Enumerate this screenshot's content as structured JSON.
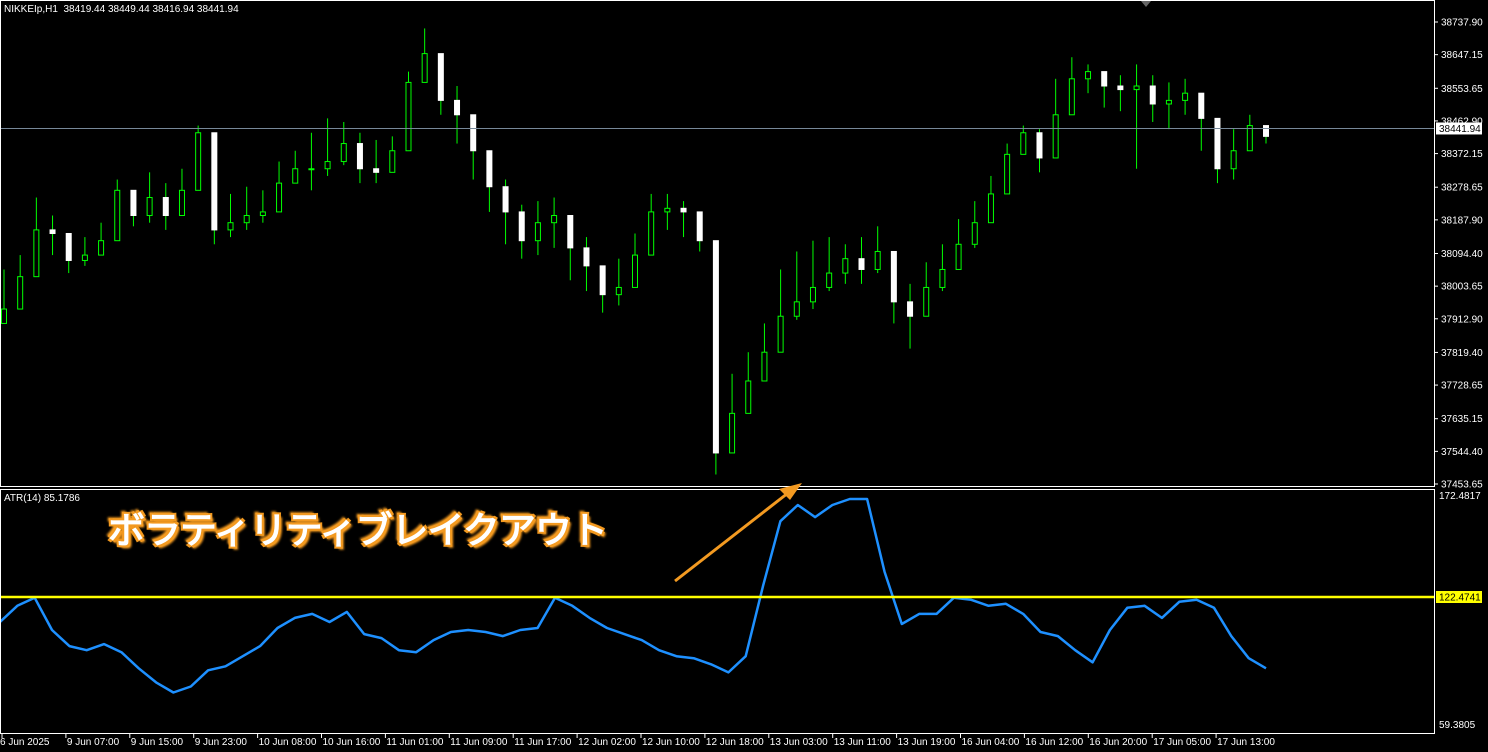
{
  "symbol_info": "NIKKEIp,H1  38419.44 38449.44 38416.94 38441.94",
  "atr_info": "ATR(14) 85.1786",
  "annotation": "ボラティリティブレイクアウト",
  "colors": {
    "background": "#000000",
    "bull_candle": "#00ff00",
    "body_fill": "#ffffff",
    "atr_line": "#1e90ff",
    "level_line": "#ffff00",
    "current_price_line": "#778899",
    "arrow": "#f39a21",
    "axis": "#ffffff"
  },
  "price_axis": {
    "ticks": [
      "38737.90",
      "38647.15",
      "38553.65",
      "38462.90",
      "38372.15",
      "38278.65",
      "38187.90",
      "38094.40",
      "38003.65",
      "37912.90",
      "37819.40",
      "37728.65",
      "37635.15",
      "37544.40",
      "37453.65"
    ],
    "current_label": "38441.94"
  },
  "atr_axis": {
    "top_label": "172.4817",
    "bottom_label": "59.3805",
    "level_label": "122.4741"
  },
  "time_axis": {
    "labels": [
      "6 Jun 2025",
      "9 Jun 07:00",
      "9 Jun 15:00",
      "9 Jun 23:00",
      "10 Jun 08:00",
      "10 Jun 16:00",
      "11 Jun 01:00",
      "11 Jun 09:00",
      "11 Jun 17:00",
      "12 Jun 02:00",
      "12 Jun 10:00",
      "12 Jun 18:00",
      "13 Jun 03:00",
      "13 Jun 11:00",
      "13 Jun 19:00",
      "16 Jun 04:00",
      "16 Jun 12:00",
      "16 Jun 20:00",
      "17 Jun 05:00",
      "17 Jun 13:00"
    ]
  },
  "chart_data": [
    {
      "type": "candlestick",
      "title": "NIKKEIp,H1",
      "ylim": [
        37453.65,
        38775
      ],
      "close": [
        37940,
        38030,
        38160,
        38150,
        38075,
        38090,
        38130,
        38270,
        38200,
        38250,
        38200,
        38270,
        38430,
        38160,
        38180,
        38200,
        38210,
        38290,
        38330,
        38330,
        38350,
        38400,
        38330,
        38320,
        38380,
        38570,
        38650,
        38520,
        38480,
        38380,
        38280,
        38210,
        38130,
        38180,
        38200,
        38110,
        38060,
        37980,
        38000,
        38090,
        38210,
        38220,
        38210,
        38130,
        37540,
        37650,
        37740,
        37820,
        37920,
        37960,
        38000,
        38040,
        38080,
        38050,
        38100,
        37960,
        37920,
        38000,
        38050,
        38120,
        38180,
        38260,
        38370,
        38430,
        38360,
        38480,
        38580,
        38600,
        38560,
        38550,
        38560,
        38510,
        38520,
        38540,
        38470,
        38330,
        38380,
        38450,
        38420
      ],
      "high": [
        38050,
        38090,
        38250,
        38200,
        38120,
        38140,
        38180,
        38300,
        38260,
        38320,
        38290,
        38330,
        38450,
        38240,
        38260,
        38280,
        38270,
        38350,
        38380,
        38430,
        38470,
        38460,
        38430,
        38410,
        38420,
        38600,
        38720,
        38640,
        38560,
        38480,
        38360,
        38300,
        38230,
        38240,
        38250,
        38180,
        38140,
        38060,
        38080,
        38150,
        38260,
        38260,
        38240,
        38180,
        37730,
        37760,
        37820,
        37900,
        38050,
        38100,
        38130,
        38140,
        38120,
        38140,
        38170,
        38040,
        38010,
        38070,
        38120,
        38190,
        38240,
        38310,
        38400,
        38450,
        38440,
        38580,
        38640,
        38620,
        38600,
        38590,
        38620,
        38590,
        38570,
        38580,
        38540,
        38470,
        38440,
        38480,
        38450
      ],
      "low": [
        37900,
        37990,
        38130,
        38090,
        38040,
        38060,
        38100,
        38200,
        38170,
        38180,
        38160,
        38240,
        38390,
        38120,
        38140,
        38160,
        38180,
        38250,
        38290,
        38270,
        38310,
        38340,
        38290,
        38290,
        38320,
        38510,
        38590,
        38480,
        38400,
        38300,
        38210,
        38120,
        38080,
        38090,
        38110,
        38020,
        37990,
        37930,
        37950,
        38040,
        38130,
        38160,
        38140,
        38100,
        37480,
        37560,
        37680,
        37760,
        37860,
        37910,
        37940,
        37990,
        38010,
        38010,
        38040,
        37900,
        37830,
        37960,
        37990,
        38060,
        38110,
        38200,
        38310,
        38380,
        38320,
        38410,
        38510,
        38540,
        38500,
        38490,
        38330,
        38460,
        38440,
        38480,
        38380,
        38290,
        38300,
        38380,
        38400
      ]
    },
    {
      "type": "line",
      "title": "ATR(14) 85.1786",
      "ylim": [
        59.3805,
        172.4817
      ],
      "level": 122.4741,
      "values": [
        110,
        118,
        122,
        106,
        98,
        96,
        99,
        95,
        87,
        80,
        75,
        78,
        86,
        88,
        93,
        98,
        107,
        112,
        114,
        110,
        115,
        104,
        102,
        96,
        95,
        101,
        105,
        106,
        105,
        103,
        106,
        107,
        122,
        118,
        112,
        107,
        104,
        101,
        96,
        93,
        92,
        89,
        85,
        93,
        128,
        160,
        168,
        162,
        168,
        171,
        171,
        135,
        109,
        114,
        114,
        122,
        121,
        118,
        119,
        114,
        105,
        103,
        96,
        90,
        106,
        117,
        118,
        112,
        120,
        121,
        117,
        103,
        92,
        87
      ]
    }
  ]
}
